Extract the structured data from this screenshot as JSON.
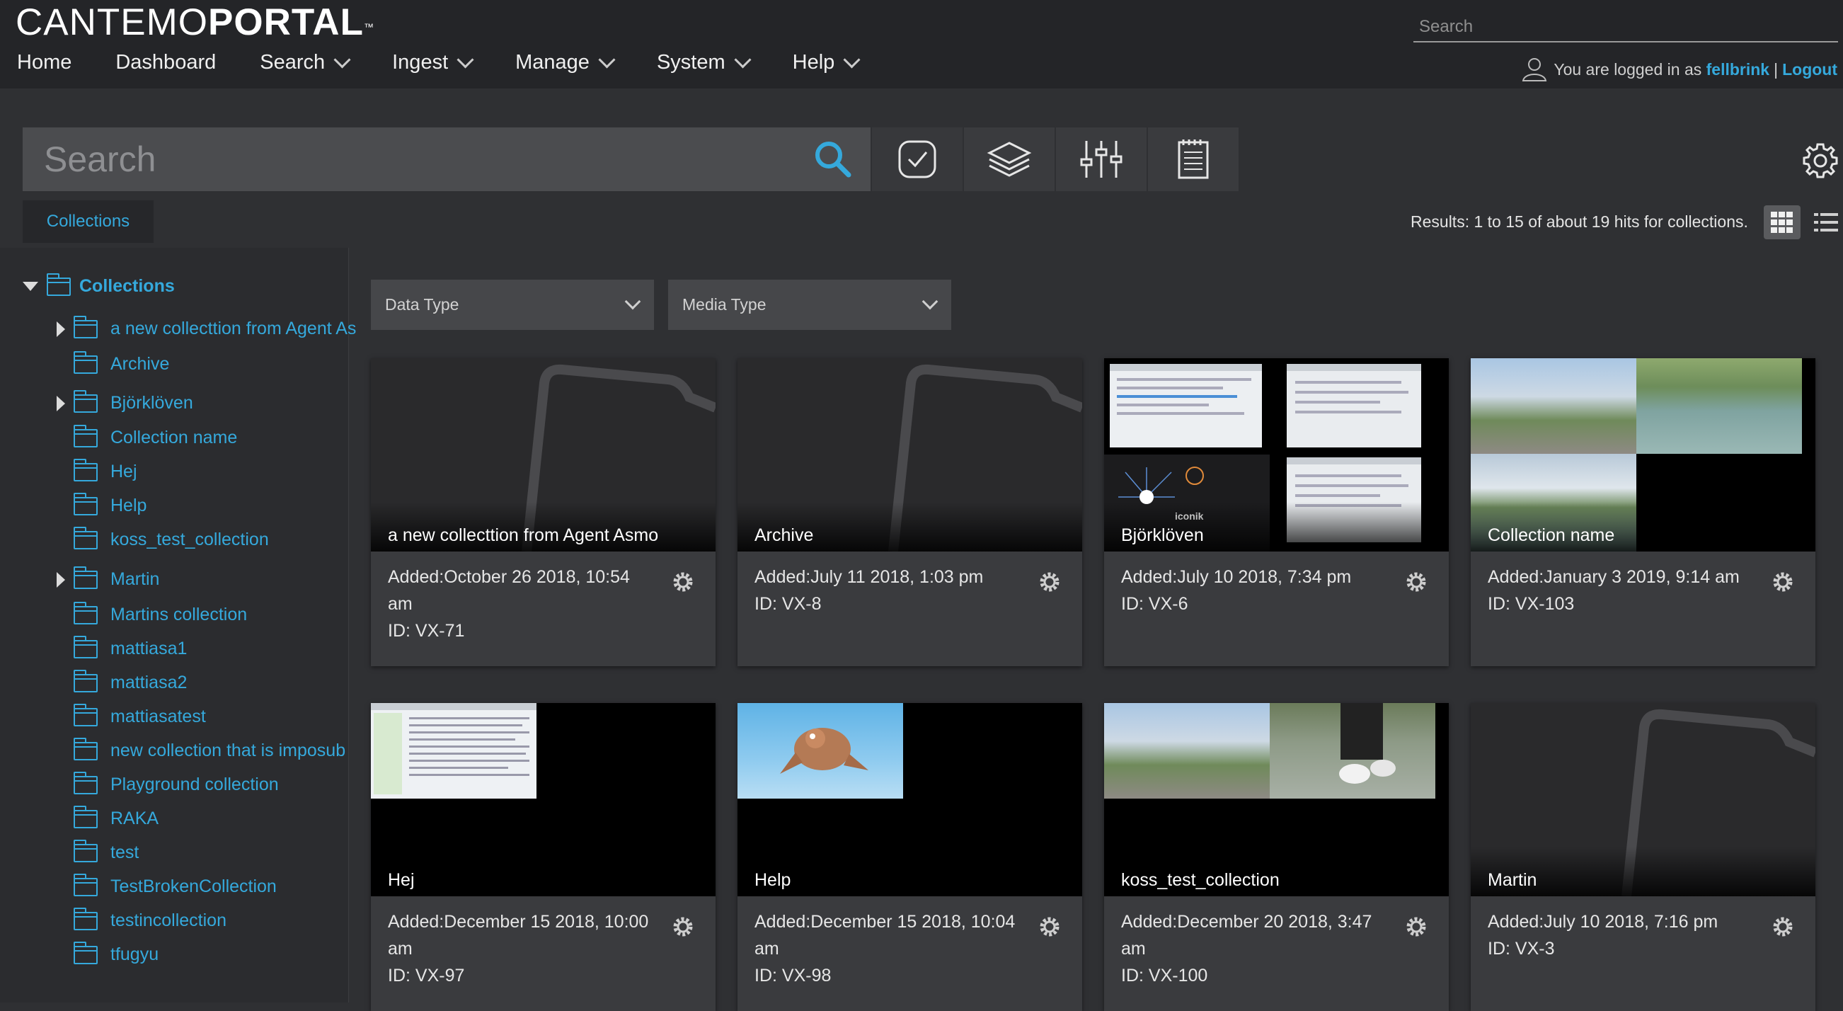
{
  "app": {
    "logo_light": "CANTEMO",
    "logo_bold": "PORTAL",
    "logo_tm": "™"
  },
  "top_search": {
    "placeholder": "Search"
  },
  "nav": [
    "Home",
    "Dashboard",
    "Search",
    "Ingest",
    "Manage",
    "System",
    "Help"
  ],
  "user": {
    "prefix": "You are logged in as",
    "name": "fellbrink",
    "separator": "|",
    "logout": "Logout"
  },
  "search": {
    "placeholder": "Search"
  },
  "toolbar_icons": [
    "search-icon",
    "checkmark-icon",
    "layers-icon",
    "sliders-icon",
    "notepad-icon"
  ],
  "collections_tab": "Collections",
  "results_text": "Results: 1 to 15 of about 19 hits for collections.",
  "tree": {
    "root": "Collections",
    "items": [
      {
        "label": "a new collecttion from Agent As",
        "expandable": true
      },
      {
        "label": "Archive",
        "expandable": false
      },
      {
        "label": "Björklöven",
        "expandable": true
      },
      {
        "label": "Collection name",
        "expandable": false
      },
      {
        "label": "Hej",
        "expandable": false
      },
      {
        "label": "Help",
        "expandable": false
      },
      {
        "label": "koss_test_collection",
        "expandable": false
      },
      {
        "label": "Martin",
        "expandable": true
      },
      {
        "label": "Martins collection",
        "expandable": false
      },
      {
        "label": "mattiasa1",
        "expandable": false
      },
      {
        "label": "mattiasa2",
        "expandable": false
      },
      {
        "label": "mattiasatest",
        "expandable": false
      },
      {
        "label": "new collection that is imposub",
        "expandable": false
      },
      {
        "label": "Playground collection",
        "expandable": false
      },
      {
        "label": "RAKA",
        "expandable": false
      },
      {
        "label": "test",
        "expandable": false
      },
      {
        "label": "TestBrokenCollection",
        "expandable": false
      },
      {
        "label": "testincollection",
        "expandable": false
      },
      {
        "label": "tfugyu",
        "expandable": false
      }
    ]
  },
  "filters": {
    "data_type": "Data Type",
    "media_type": "Media Type"
  },
  "cards": [
    {
      "title": "a new collecttion from Agent Asmo",
      "added": "Added:October 26 2018, 10:54 am",
      "id": "ID: VX-71"
    },
    {
      "title": "Archive",
      "added": "Added:July 11 2018, 1:03 pm",
      "id": "ID: VX-8"
    },
    {
      "title": "Björklöven",
      "added": "Added:July 10 2018, 7:34 pm",
      "id": "ID: VX-6"
    },
    {
      "title": "Collection name",
      "added": "Added:January 3 2019, 9:14 am",
      "id": "ID: VX-103"
    },
    {
      "title": "Hej",
      "added": "Added:December 15 2018, 10:00 am",
      "id": "ID: VX-97"
    },
    {
      "title": "Help",
      "added": "Added:December 15 2018, 10:04 am",
      "id": "ID: VX-98"
    },
    {
      "title": "koss_test_collection",
      "added": "Added:December 20 2018, 3:47 am",
      "id": "ID: VX-100"
    },
    {
      "title": "Martin",
      "added": "Added:July 10 2018, 7:16 pm",
      "id": "ID: VX-3"
    }
  ],
  "thumb_text": {
    "iconik": "iconik"
  },
  "colors": {
    "accent": "#35a9dc",
    "background": "#2f3033",
    "header": "#242528"
  }
}
